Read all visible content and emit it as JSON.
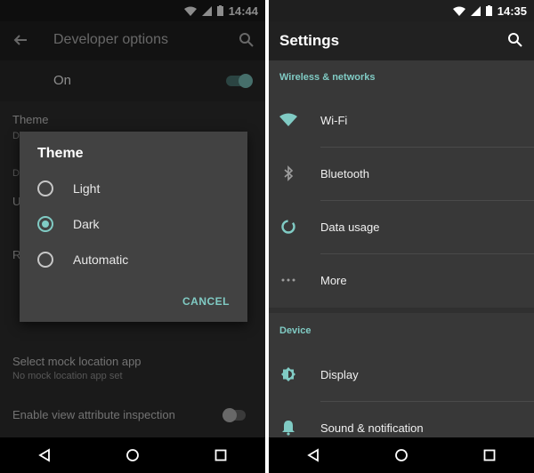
{
  "left": {
    "status_time": "14:44",
    "toolbar_title": "Developer options",
    "master_switch_label": "On",
    "theme_pref_label": "Theme",
    "partial_rows": [
      "D",
      "U",
      "R"
    ],
    "mock_location_title": "Select mock location app",
    "mock_location_summary": "No mock location app set",
    "view_attr_label": "Enable view attribute inspection",
    "dialog": {
      "title": "Theme",
      "options": [
        {
          "label": "Light",
          "selected": false
        },
        {
          "label": "Dark",
          "selected": true
        },
        {
          "label": "Automatic",
          "selected": false
        }
      ],
      "cancel_label": "CANCEL"
    }
  },
  "right": {
    "status_time": "14:35",
    "toolbar_title": "Settings",
    "sections": [
      {
        "header": "Wireless & networks",
        "items": [
          {
            "label": "Wi-Fi",
            "icon": "wifi-icon"
          },
          {
            "label": "Bluetooth",
            "icon": "bluetooth-icon"
          },
          {
            "label": "Data usage",
            "icon": "data-usage-icon"
          },
          {
            "label": "More",
            "icon": "more-icon"
          }
        ]
      },
      {
        "header": "Device",
        "items": [
          {
            "label": "Display",
            "icon": "display-icon"
          },
          {
            "label": "Sound & notification",
            "icon": "bell-icon"
          }
        ]
      }
    ]
  },
  "colors": {
    "accent": "#80cbc4",
    "background": "#303030",
    "dialog": "#424242"
  }
}
